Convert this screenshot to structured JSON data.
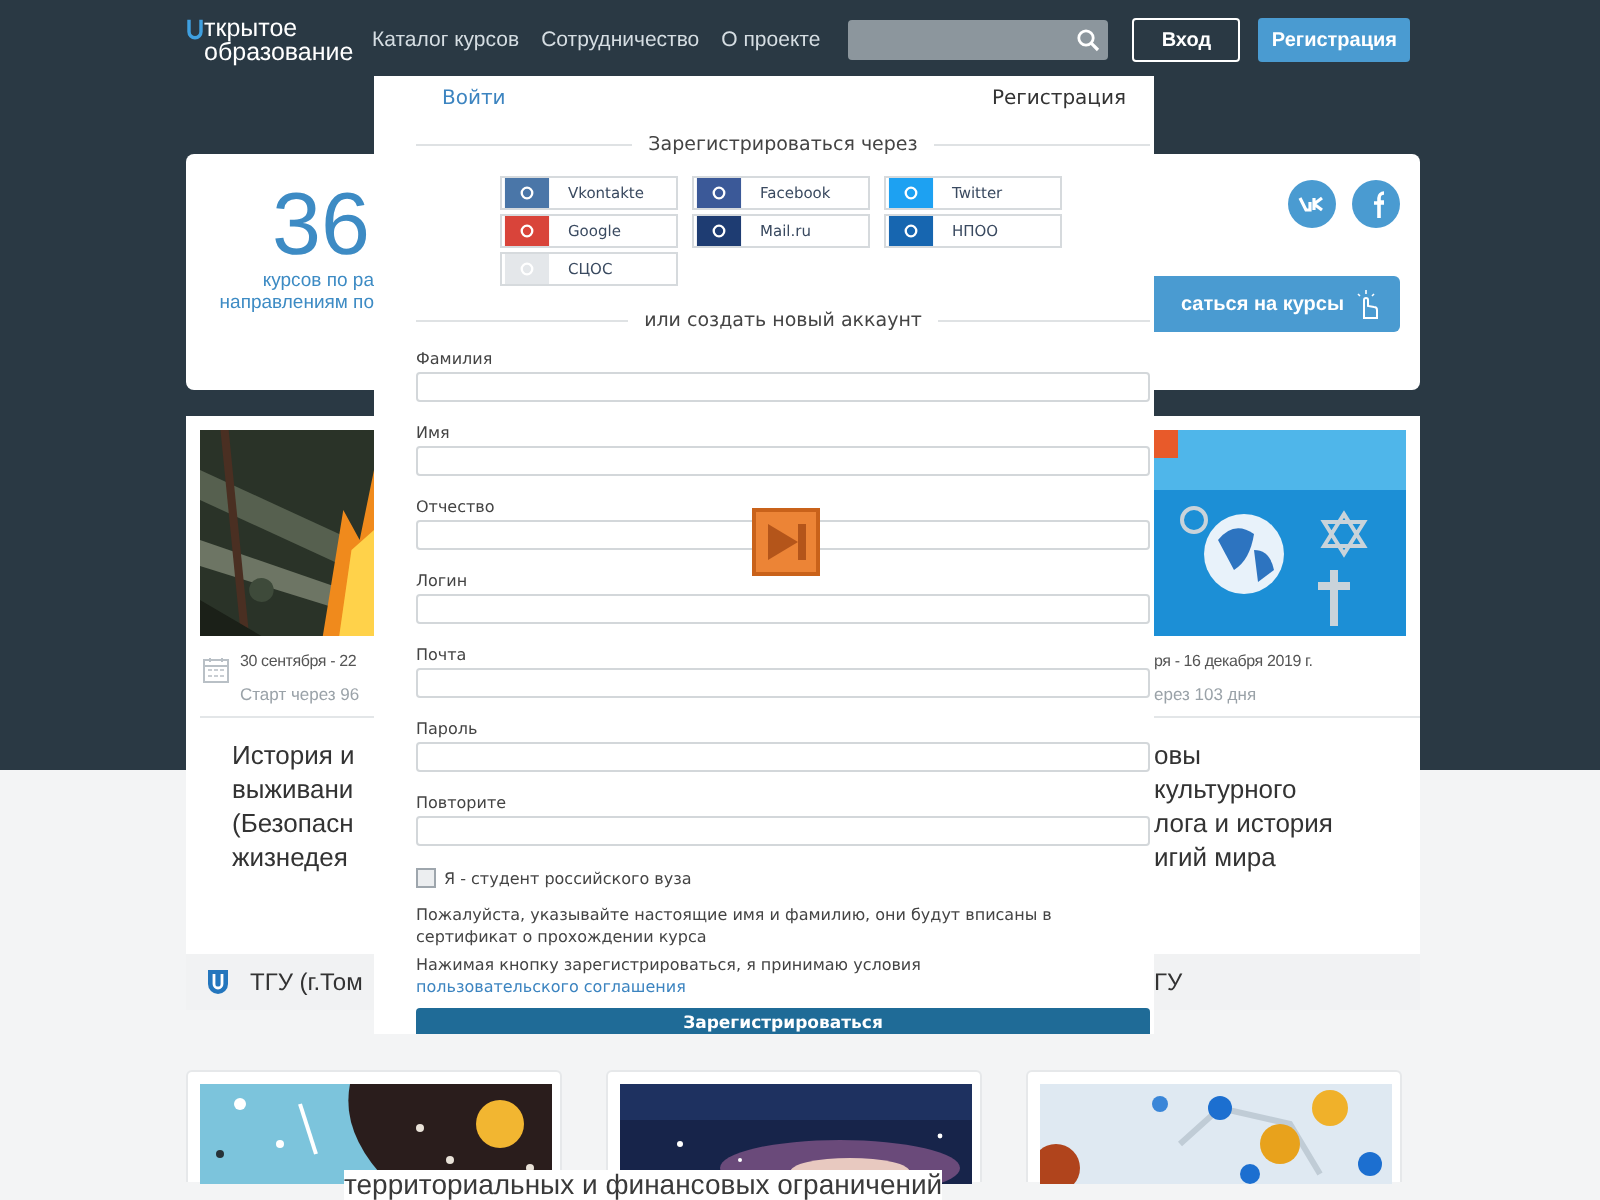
{
  "header": {
    "logo": [
      "ткрытое",
      "образование"
    ],
    "nav": [
      "Каталог курсов",
      "Сотрудничество",
      "О проекте"
    ],
    "buttons": [
      {
        "label": "Вход",
        "kind": "outline"
      },
      {
        "label": "Регистрация",
        "kind": "primary"
      }
    ]
  },
  "hero": {
    "count": "36",
    "caption": [
      "курсов по ра",
      "направлениям по"
    ],
    "button": "саться на курсы"
  },
  "courses": [
    {
      "date": "30 сентября - 22",
      "start": "Старт через 96",
      "title": [
        "История и",
        "выживани",
        "(Безопасн",
        "жизнедея"
      ],
      "university": "ТГУ (г.Том"
    },
    {
      "date": "ря - 16 декабря 2019 г.",
      "start": "ерез 103 дня",
      "title": [
        "овы",
        "культурного",
        "лога и история",
        "игий мира"
      ],
      "university": "ГУ"
    }
  ],
  "modal": {
    "tabs": [
      {
        "label": "Войти",
        "selected": false
      },
      {
        "label": "Регистрация",
        "selected": true
      }
    ],
    "social_heading": "Зарегистрироваться через",
    "providers": [
      {
        "label": "Vkontakte",
        "color": "#4a76a8"
      },
      {
        "label": "Facebook",
        "color": "#3b5998"
      },
      {
        "label": "Twitter",
        "color": "#1da1f2"
      },
      {
        "label": "Google",
        "color": "#d9443a"
      },
      {
        "label": "Mail.ru",
        "color": "#1e3c72"
      },
      {
        "label": "НПОО",
        "color": "#1766b0"
      },
      {
        "label": "СЦОС",
        "color": "#e4e7ea"
      }
    ],
    "create_heading": "или создать новый аккаунт",
    "fields": [
      {
        "label": "Фамилия"
      },
      {
        "label": "Имя"
      },
      {
        "label": "Отчество"
      },
      {
        "label": "Логин"
      },
      {
        "label": "Почта"
      },
      {
        "label": "Пароль"
      },
      {
        "label": "Повторите"
      }
    ],
    "student": {
      "label": "Я - студент российского вуза",
      "checked": false
    },
    "note": "Пожалуйста, указывайте настоящие имя и фамилию, они будут вписаны в сертификат о прохождении курса",
    "agreement": {
      "text": "Нажимая кнопку зарегистрироваться, я принимаю условия",
      "link": "пользовательского соглашения"
    },
    "submit": "Зарегистрироваться"
  },
  "caption": "территориальных и финансовых ограничений"
}
